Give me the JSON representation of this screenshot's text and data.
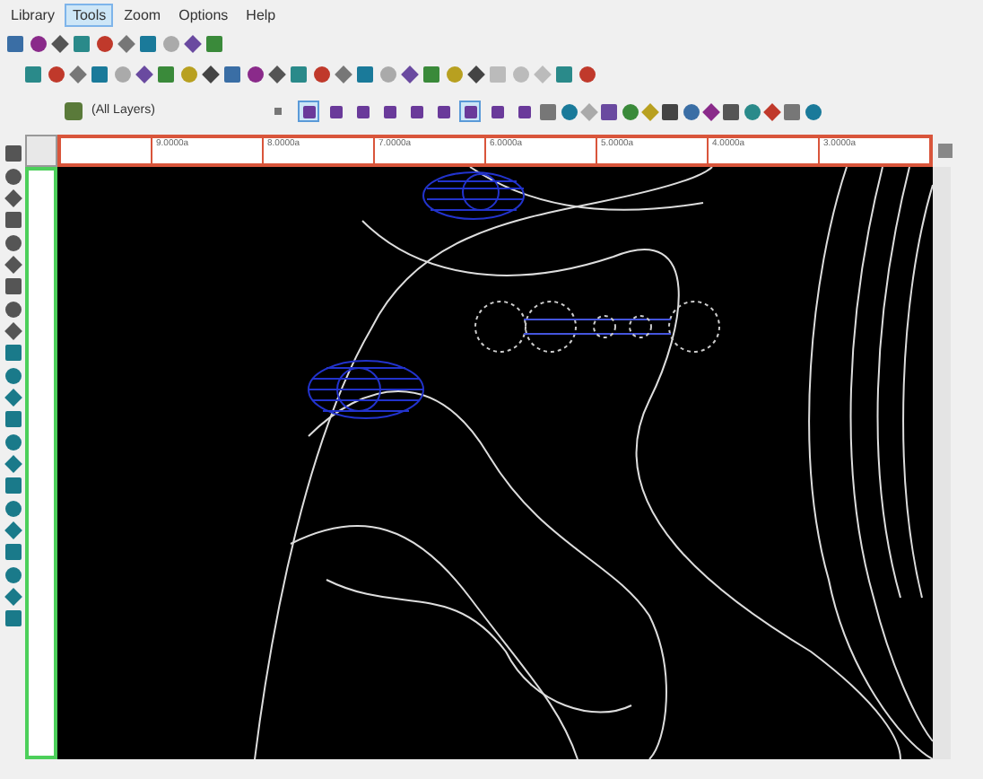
{
  "menu": [
    {
      "label": "Library",
      "selected": false
    },
    {
      "label": "Tools",
      "selected": true
    },
    {
      "label": "Zoom",
      "selected": false
    },
    {
      "label": "Options",
      "selected": false
    },
    {
      "label": "Help",
      "selected": false
    }
  ],
  "layer_dropdown": {
    "value": "(All Layers)"
  },
  "view_buttons": [
    {
      "selected": true
    },
    {
      "selected": false
    },
    {
      "selected": false
    },
    {
      "selected": false
    },
    {
      "selected": false
    },
    {
      "selected": false
    },
    {
      "selected": true
    },
    {
      "selected": false
    },
    {
      "selected": false
    }
  ],
  "ruler": {
    "labels": [
      "9.0000a",
      "8.0000a",
      "7.0000a",
      "6.0000a",
      "5.0000a",
      "4.0000a",
      "3.0000a"
    ]
  }
}
